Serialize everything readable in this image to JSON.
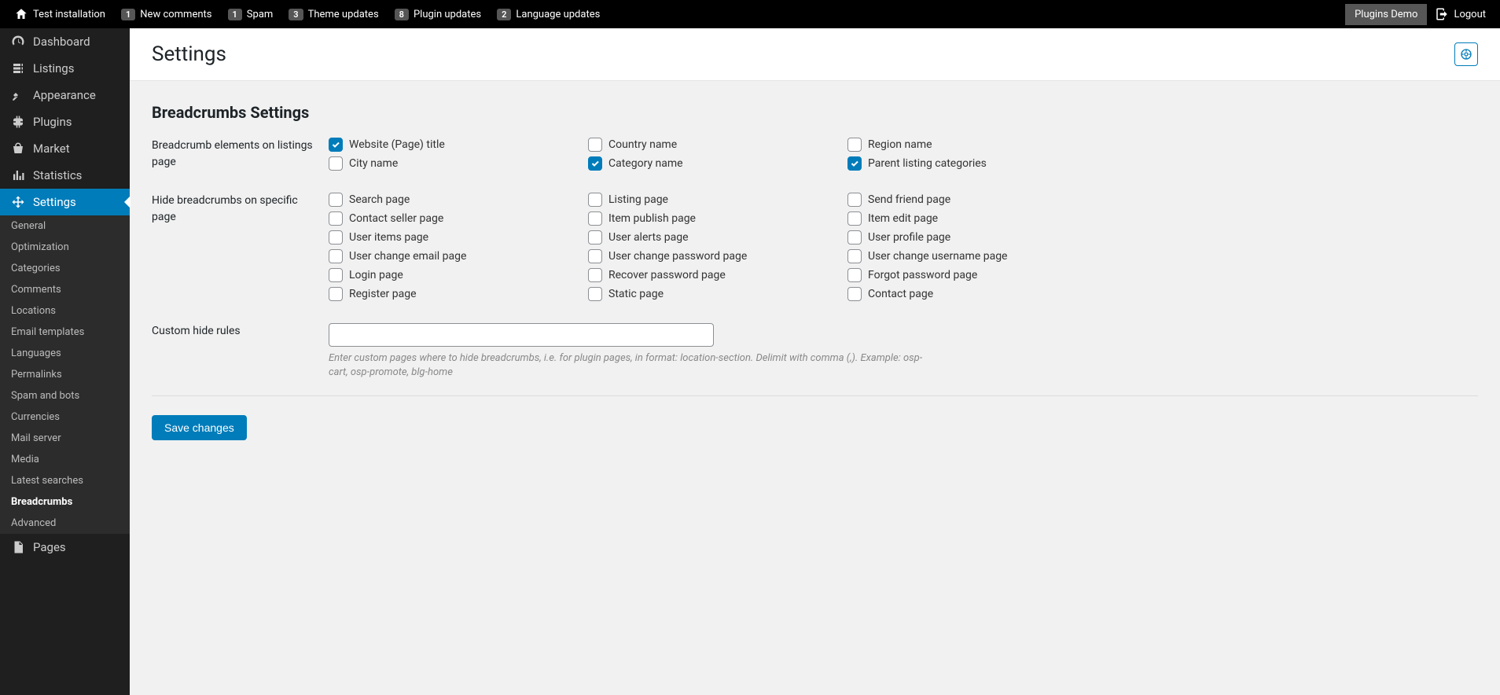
{
  "topbar": {
    "site_name": "Test installation",
    "items": [
      {
        "badge": "1",
        "label": "New comments"
      },
      {
        "badge": "1",
        "label": "Spam"
      },
      {
        "badge": "3",
        "label": "Theme updates"
      },
      {
        "badge": "8",
        "label": "Plugin updates"
      },
      {
        "badge": "2",
        "label": "Language updates"
      }
    ],
    "plugins_demo": "Plugins Demo",
    "logout": "Logout"
  },
  "sidebar": {
    "items": [
      {
        "label": "Dashboard",
        "icon": "dashboard"
      },
      {
        "label": "Listings",
        "icon": "listings"
      },
      {
        "label": "Appearance",
        "icon": "appearance"
      },
      {
        "label": "Plugins",
        "icon": "plugins"
      },
      {
        "label": "Market",
        "icon": "market"
      },
      {
        "label": "Statistics",
        "icon": "statistics"
      },
      {
        "label": "Settings",
        "icon": "settings",
        "active": true
      },
      {
        "label": "Pages",
        "icon": "pages"
      }
    ],
    "submenu": [
      {
        "label": "General"
      },
      {
        "label": "Optimization"
      },
      {
        "label": "Categories"
      },
      {
        "label": "Comments"
      },
      {
        "label": "Locations"
      },
      {
        "label": "Email templates"
      },
      {
        "label": "Languages"
      },
      {
        "label": "Permalinks"
      },
      {
        "label": "Spam and bots"
      },
      {
        "label": "Currencies"
      },
      {
        "label": "Mail server"
      },
      {
        "label": "Media"
      },
      {
        "label": "Latest searches"
      },
      {
        "label": "Breadcrumbs",
        "current": true
      },
      {
        "label": "Advanced"
      }
    ]
  },
  "page": {
    "title": "Settings",
    "section_title": "Breadcrumbs Settings",
    "row1_label": "Breadcrumb elements on listings page",
    "row1_options": [
      {
        "label": "Website (Page) title",
        "checked": true
      },
      {
        "label": "Country name",
        "checked": false
      },
      {
        "label": "Region name",
        "checked": false
      },
      {
        "label": "City name",
        "checked": false
      },
      {
        "label": "Category name",
        "checked": true
      },
      {
        "label": "Parent listing categories",
        "checked": true
      }
    ],
    "row2_label": "Hide breadcrumbs on specific page",
    "row2_options": [
      {
        "label": "Search page",
        "checked": false
      },
      {
        "label": "Listing page",
        "checked": false
      },
      {
        "label": "Send friend page",
        "checked": false
      },
      {
        "label": "Contact seller page",
        "checked": false
      },
      {
        "label": "Item publish page",
        "checked": false
      },
      {
        "label": "Item edit page",
        "checked": false
      },
      {
        "label": "User items page",
        "checked": false
      },
      {
        "label": "User alerts page",
        "checked": false
      },
      {
        "label": "User profile page",
        "checked": false
      },
      {
        "label": "User change email page",
        "checked": false
      },
      {
        "label": "User change password page",
        "checked": false
      },
      {
        "label": "User change username page",
        "checked": false
      },
      {
        "label": "Login page",
        "checked": false
      },
      {
        "label": "Recover password page",
        "checked": false
      },
      {
        "label": "Forgot password page",
        "checked": false
      },
      {
        "label": "Register page",
        "checked": false
      },
      {
        "label": "Static page",
        "checked": false
      },
      {
        "label": "Contact page",
        "checked": false
      }
    ],
    "row3_label": "Custom hide rules",
    "row3_value": "",
    "row3_help": "Enter custom pages where to hide breadcrumbs, i.e. for plugin pages, in format: location-section. Delimit with comma (,). Example: osp-cart, osp-promote, blg-home",
    "save_label": "Save changes"
  }
}
